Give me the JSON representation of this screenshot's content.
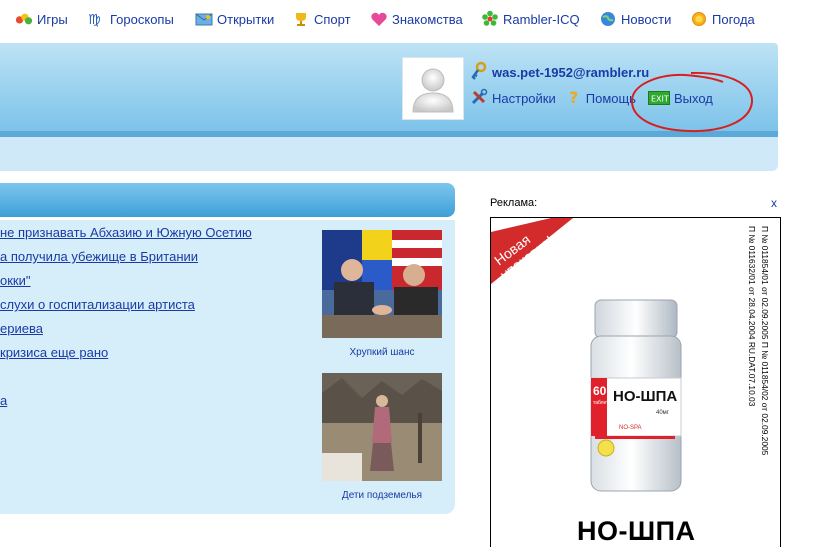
{
  "nav": [
    {
      "label": "Игры",
      "icon": "games-icon"
    },
    {
      "label": "Гороскопы",
      "icon": "zodiac-icon"
    },
    {
      "label": "Открытки",
      "icon": "postcard-icon"
    },
    {
      "label": "Спорт",
      "icon": "trophy-icon"
    },
    {
      "label": "Знакомства",
      "icon": "heart-icon"
    },
    {
      "label": "Rambler-ICQ",
      "icon": "icq-flower-icon"
    },
    {
      "label": "Новости",
      "icon": "globe-icon"
    },
    {
      "label": "Погода",
      "icon": "sun-icon"
    }
  ],
  "user": {
    "email": "was.pet-1952@rambler.ru",
    "settings": "Настройки",
    "help": "Помощь",
    "logout": "Выход",
    "exit_badge": "EXIT"
  },
  "news": {
    "items": [
      "не признавать Абхазию и Южную Осетию",
      "а получила убежище в Британии",
      "окки\"",
      "слухи о госпитализации артиста",
      "ериева",
      "кризиса еще рано",
      "а"
    ],
    "photos": [
      {
        "caption": "Хрупкий шанс"
      },
      {
        "caption": "Дети подземелья"
      }
    ]
  },
  "ad": {
    "label": "Реклама:",
    "close": "x",
    "ribbon_line1": "Новая",
    "ribbon_line2": "упаковка!",
    "product": "НО-ШПА",
    "product_sub": "NO-SPA",
    "dose": "40мг",
    "count": "60",
    "count_unit": "таблеток",
    "brand": "НО-ШПА",
    "reg_line1": "П № 011854/01 от 02.09.2005  П № 011854/02 от 02.09.2005",
    "reg_line2": "П № 011632/01 от 28.04.2004  RU.DAT.07.10.03"
  },
  "colors": {
    "link": "#1a3aa6",
    "header": "#7ec3ea",
    "panel": "#d6eefa",
    "annotation": "#d62020"
  }
}
